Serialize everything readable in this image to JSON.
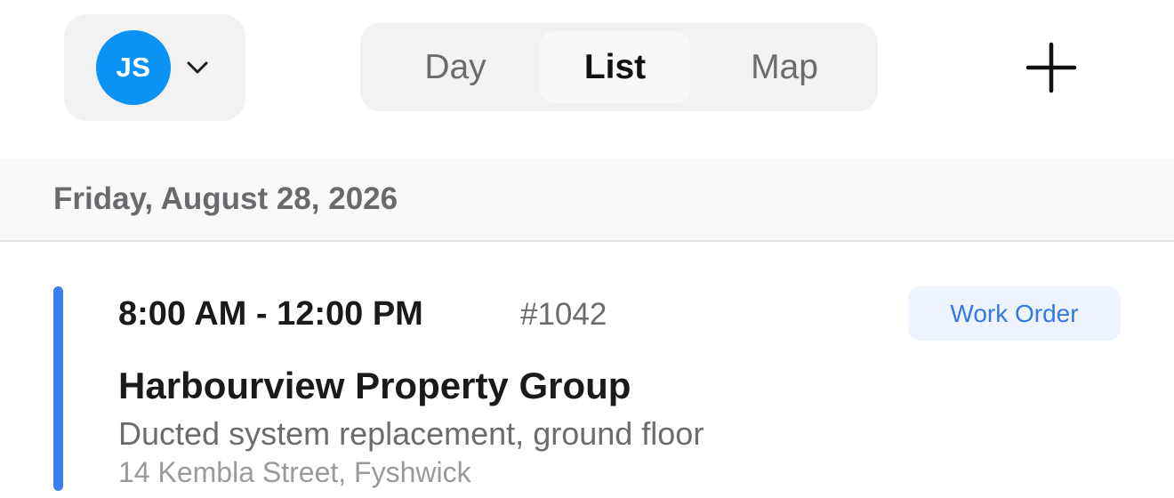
{
  "header": {
    "user": {
      "initials": "JS",
      "avatar_color": "#0a93f5",
      "dropdown_icon": "chevron-down-icon"
    },
    "view_tabs": [
      {
        "label": "Day",
        "selected": false
      },
      {
        "label": "List",
        "selected": true
      },
      {
        "label": "Map",
        "selected": false
      }
    ],
    "add_icon": "plus-icon"
  },
  "date_header": "Friday, August 28, 2026",
  "job": {
    "time": "8:00 AM - 12:00 PM",
    "number": "#1042",
    "type": "Work Order",
    "client": "Harbourview Property Group",
    "description": "Ducted system replacement, ground floor",
    "address": "14 Kembla Street, Fyshwick",
    "accent_color": "#3d7ef2"
  }
}
